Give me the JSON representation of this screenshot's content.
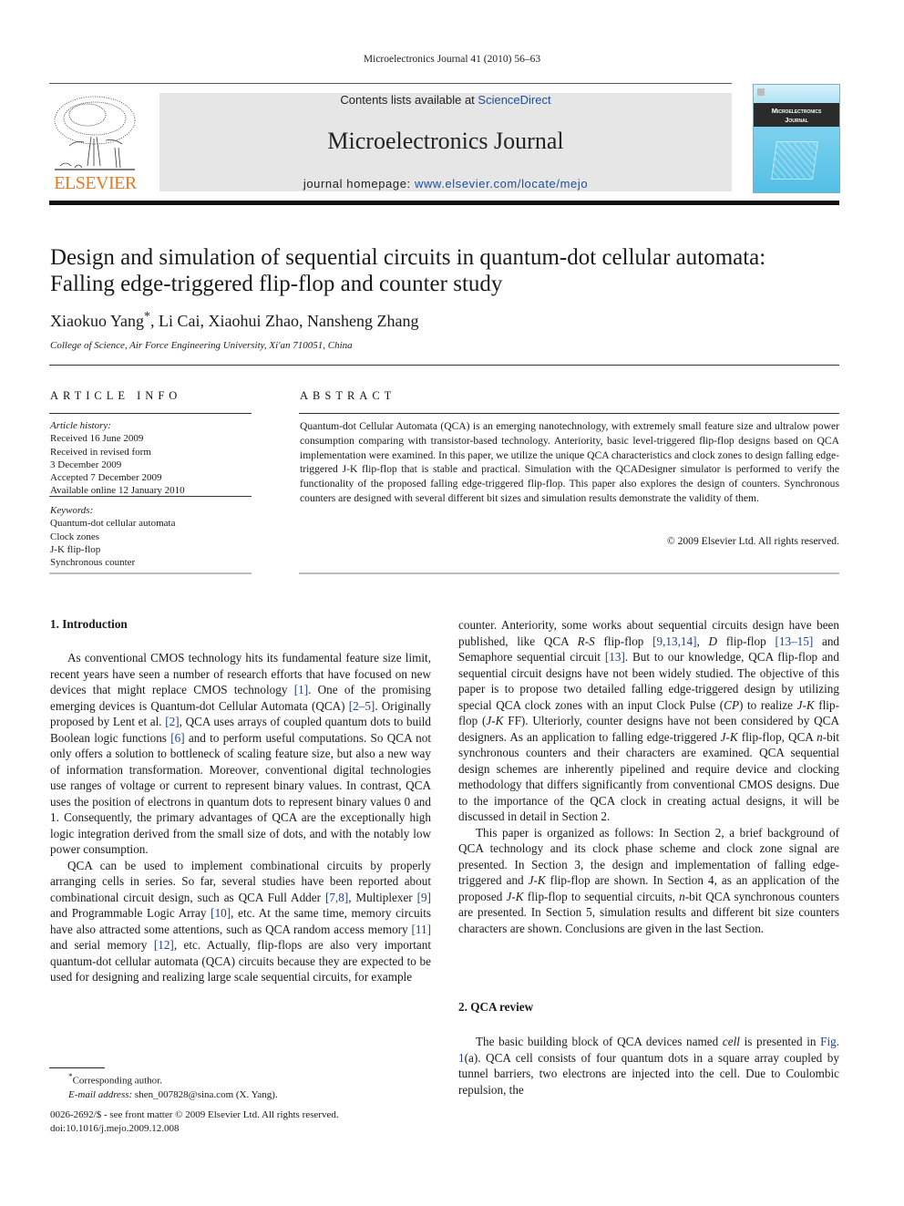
{
  "running_head": "Microelectronics Journal 41 (2010) 56–63",
  "banner": {
    "contents_prefix": "Contents lists available at ",
    "contents_link": "ScienceDirect",
    "journal_title": "Microelectronics Journal",
    "homepage_prefix": "journal homepage: ",
    "homepage_url": "www.elsevier.com/locate/mejo"
  },
  "publisher_logo": "ELSEVIER",
  "cover": {
    "title_line1": "Microelectronics",
    "title_line2": "Journal"
  },
  "article": {
    "title": "Design and simulation of sequential circuits in quantum-dot cellular automata: Falling edge-triggered flip-flop and counter study",
    "authors": [
      {
        "name": "Xiaokuo Yang",
        "mark": "*"
      },
      {
        "name": "Li Cai"
      },
      {
        "name": "Xiaohui Zhao"
      },
      {
        "name": "Nansheng Zhang"
      }
    ],
    "authors_text_1": "Xiaokuo Yang",
    "author_mark": "*",
    "authors_text_2": ", Li Cai, Xiaohui Zhao, Nansheng Zhang",
    "affiliation": "College of Science, Air Force Engineering University, Xi'an 710051, China"
  },
  "article_info": {
    "heading": "ARTICLE INFO",
    "history_label": "Article history:",
    "history": [
      "Received 16 June 2009",
      "Received in revised form",
      "3 December 2009",
      "Accepted 7 December 2009",
      "Available online 12 January 2010"
    ],
    "keywords_label": "Keywords:",
    "keywords": [
      "Quantum-dot cellular automata",
      "Clock zones",
      "J-K flip-flop",
      "Synchronous counter"
    ]
  },
  "abstract": {
    "heading": "ABSTRACT",
    "text": "Quantum-dot Cellular Automata (QCA) is an emerging nanotechnology, with extremely small feature size and ultralow power consumption comparing with transistor-based technology. Anteriority, basic level-triggered flip-flop designs based on QCA implementation were examined. In this paper, we utilize the unique QCA characteristics and clock zones to design falling edge-triggered J-K flip-flop that is stable and practical. Simulation with the QCADesigner simulator is performed to verify the functionality of the proposed falling edge-triggered flip-flop. This paper also explores the design of counters. Synchronous counters are designed with several different bit sizes and simulation results demonstrate the validity of them.",
    "copyright": "© 2009 Elsevier Ltd. All rights reserved."
  },
  "sections": {
    "intro_heading": "1.  Introduction",
    "intro_p1": [
      "As conventional CMOS technology hits its fundamental feature size limit, recent years have seen a number of research efforts that have focused on new devices that might replace CMOS technology ",
      "[1]",
      ". One of the promising emerging devices is Quantum-dot Cellular Automata (QCA) ",
      "[2–5]",
      ". Originally proposed by Lent et al. ",
      "[2]",
      ", QCA uses arrays of coupled quantum dots to build Boolean logic functions ",
      "[6]",
      " and to perform useful computations. So QCA not only offers a solution to bottleneck of scaling feature size, but also a new way of information transformation. Moreover, conventional digital technologies use ranges of voltage or current to represent binary values. In contrast, QCA uses the position of electrons in quantum dots to represent binary values 0 and 1. Consequently, the primary advantages of QCA are the exceptionally high logic integration derived from the small size of dots, and with the notably low power consumption."
    ],
    "intro_p2": [
      "QCA can be used to implement combinational circuits by properly arranging cells in series. So far, several studies have been reported about combinational circuit design, such as QCA Full Adder ",
      "[7,8]",
      ", Multiplexer ",
      "[9]",
      " and Programmable Logic Array ",
      "[10]",
      ", etc. At the same time, memory circuits have also attracted some attentions, such as QCA random access memory ",
      "[11]",
      " and serial memory ",
      "[12]",
      ", etc. Actually, flip-flops are also very important quantum-dot cellular automata (QCA) circuits because they are expected to be used for designing and realizing large scale sequential circuits, for example"
    ],
    "right_p1": [
      "counter. Anteriority, some works about sequential circuits design have been published, like QCA ",
      "R-S",
      " flip-flop ",
      "[9,13,14]",
      ", ",
      "D",
      " flip-flop ",
      "[13–15]",
      " and Semaphore sequential circuit ",
      "[13]",
      ". But to our knowledge, QCA flip-flop and sequential circuit designs have not been widely studied. The objective of this paper is to propose two detailed falling edge-triggered design by utilizing special QCA clock zones with an input Clock Pulse (",
      "CP",
      ") to realize ",
      "J-K",
      " flip-flop (",
      "J-K",
      " FF). Ulteriorly, counter designs have not been considered by QCA designers. As an application to falling edge-triggered ",
      "J-K",
      " flip-flop, QCA ",
      "n",
      "-bit synchronous counters and their characters are examined. QCA sequential design schemes are inherently pipelined and require device and clocking methodology that differs significantly from conventional CMOS designs. Due to the importance of the QCA clock in creating actual designs, it will be discussed in detail in Section 2."
    ],
    "right_p2": [
      "This paper is organized as follows: In Section 2, a brief background of QCA technology and its clock phase scheme and clock zone signal are presented. In Section 3, the design and implementation of falling edge-triggered and ",
      "J-K",
      " flip-flop are shown. In Section 4, as an application of the proposed ",
      "J-K",
      " flip-flop to sequential circuits, ",
      "n",
      "-bit QCA synchronous counters are presented. In Section 5, simulation results and different bit size counters characters are shown. Conclusions are given in the last Section."
    ],
    "review_heading": "2.  QCA review",
    "review_p1": [
      "The basic building block of QCA devices named ",
      "cell",
      " is presented in ",
      "Fig. 1",
      "(a). QCA cell consists of four quantum dots in a square array coupled by tunnel barriers, two electrons are injected into the cell. Due to Coulombic repulsion, the"
    ]
  },
  "footnote": {
    "mark": "*",
    "corresponding": "Corresponding author.",
    "email_label": "E-mail address:",
    "email": " shen_007828@sina.com (X. Yang)."
  },
  "front_matter": {
    "issn_line": "0026-2692/$ - see front matter © 2009 Elsevier Ltd. All rights reserved.",
    "doi": "doi:10.1016/j.mejo.2009.12.008"
  },
  "colors": {
    "link": "#1f4e9c",
    "elsevier_orange": "#e87722",
    "banner_bg": "#e6e6e6"
  }
}
